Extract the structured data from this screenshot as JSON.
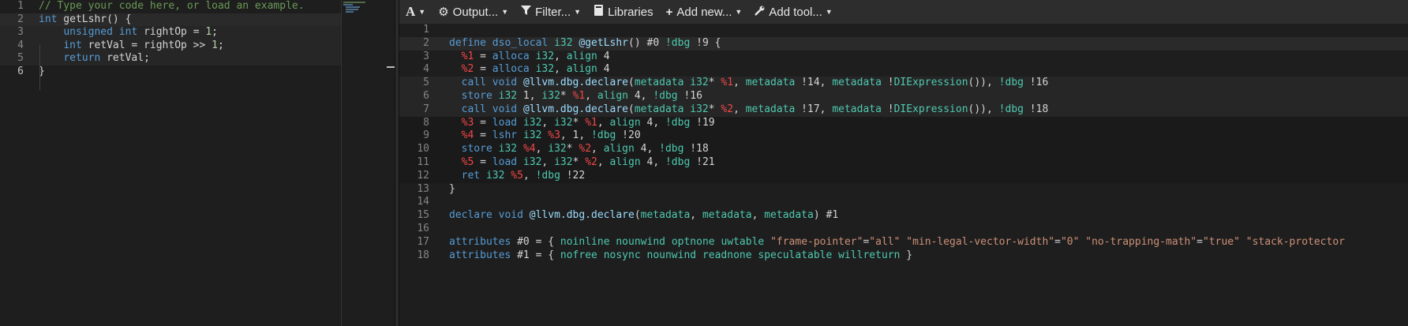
{
  "source_editor": {
    "lines": [
      {
        "num": "1",
        "segments": [
          {
            "t": "// Type your code here, or load an example.",
            "c": "tk-cm"
          }
        ]
      },
      {
        "num": "2",
        "segments": [
          {
            "t": "int",
            "c": "tk-kw"
          },
          {
            "t": " getLshr() {",
            "c": ""
          }
        ]
      },
      {
        "num": "3",
        "segments": [
          {
            "t": "    ",
            "c": ""
          },
          {
            "t": "unsigned",
            "c": "tk-kw"
          },
          {
            "t": " ",
            "c": ""
          },
          {
            "t": "int",
            "c": "tk-kw"
          },
          {
            "t": " rightOp = ",
            "c": ""
          },
          {
            "t": "1",
            "c": "tk-num"
          },
          {
            "t": ";",
            "c": ""
          }
        ]
      },
      {
        "num": "4",
        "segments": [
          {
            "t": "    ",
            "c": ""
          },
          {
            "t": "int",
            "c": "tk-kw"
          },
          {
            "t": " retVal = rightOp >> ",
            "c": ""
          },
          {
            "t": "1",
            "c": "tk-num"
          },
          {
            "t": ";",
            "c": ""
          }
        ]
      },
      {
        "num": "5",
        "segments": [
          {
            "t": "    ",
            "c": ""
          },
          {
            "t": "return",
            "c": "tk-kw"
          },
          {
            "t": " retVal;",
            "c": ""
          }
        ]
      },
      {
        "num": "6",
        "segments": [
          {
            "t": "}",
            "c": ""
          }
        ]
      }
    ]
  },
  "toolbar": {
    "font_label": "A",
    "output_label": "Output...",
    "filter_label": "Filter...",
    "libraries_label": "Libraries",
    "add_new_label": "Add new...",
    "add_tool_label": "Add tool..."
  },
  "output_editor": {
    "lines": [
      {
        "num": "1",
        "segments": []
      },
      {
        "num": "2",
        "segments": [
          {
            "t": "define",
            "c": "tk-kw"
          },
          {
            "t": " ",
            "c": ""
          },
          {
            "t": "dso_local",
            "c": "tk-kw"
          },
          {
            "t": " ",
            "c": ""
          },
          {
            "t": "i32",
            "c": "tk-type"
          },
          {
            "t": " ",
            "c": ""
          },
          {
            "t": "@getLshr",
            "c": "tk-glob"
          },
          {
            "t": "() #0 ",
            "c": ""
          },
          {
            "t": "!dbg",
            "c": "tk-meta"
          },
          {
            "t": " !9 {",
            "c": ""
          }
        ]
      },
      {
        "num": "3",
        "segments": [
          {
            "t": "  ",
            "c": ""
          },
          {
            "t": "%1",
            "c": "tk-reg"
          },
          {
            "t": " = ",
            "c": ""
          },
          {
            "t": "alloca",
            "c": "tk-kw"
          },
          {
            "t": " ",
            "c": ""
          },
          {
            "t": "i32",
            "c": "tk-type"
          },
          {
            "t": ", ",
            "c": ""
          },
          {
            "t": "align",
            "c": "tk-meta"
          },
          {
            "t": " 4",
            "c": ""
          }
        ]
      },
      {
        "num": "4",
        "segments": [
          {
            "t": "  ",
            "c": ""
          },
          {
            "t": "%2",
            "c": "tk-reg"
          },
          {
            "t": " = ",
            "c": ""
          },
          {
            "t": "alloca",
            "c": "tk-kw"
          },
          {
            "t": " ",
            "c": ""
          },
          {
            "t": "i32",
            "c": "tk-type"
          },
          {
            "t": ", ",
            "c": ""
          },
          {
            "t": "align",
            "c": "tk-meta"
          },
          {
            "t": " 4",
            "c": ""
          }
        ]
      },
      {
        "num": "5",
        "segments": [
          {
            "t": "  ",
            "c": ""
          },
          {
            "t": "call",
            "c": "tk-kw"
          },
          {
            "t": " ",
            "c": ""
          },
          {
            "t": "void",
            "c": "tk-kw"
          },
          {
            "t": " ",
            "c": ""
          },
          {
            "t": "@llvm.dbg.declare",
            "c": "tk-glob"
          },
          {
            "t": "(",
            "c": ""
          },
          {
            "t": "metadata",
            "c": "tk-meta"
          },
          {
            "t": " ",
            "c": ""
          },
          {
            "t": "i32",
            "c": "tk-type"
          },
          {
            "t": "* ",
            "c": ""
          },
          {
            "t": "%1",
            "c": "tk-reg"
          },
          {
            "t": ", ",
            "c": ""
          },
          {
            "t": "metadata",
            "c": "tk-meta"
          },
          {
            "t": " !14, ",
            "c": ""
          },
          {
            "t": "metadata",
            "c": "tk-meta"
          },
          {
            "t": " !",
            "c": ""
          },
          {
            "t": "DIExpression",
            "c": "tk-meta"
          },
          {
            "t": "()), ",
            "c": ""
          },
          {
            "t": "!dbg",
            "c": "tk-meta"
          },
          {
            "t": " !16",
            "c": ""
          }
        ]
      },
      {
        "num": "6",
        "segments": [
          {
            "t": "  ",
            "c": ""
          },
          {
            "t": "store",
            "c": "tk-kw"
          },
          {
            "t": " ",
            "c": ""
          },
          {
            "t": "i32",
            "c": "tk-type"
          },
          {
            "t": " 1, ",
            "c": ""
          },
          {
            "t": "i32",
            "c": "tk-type"
          },
          {
            "t": "* ",
            "c": ""
          },
          {
            "t": "%1",
            "c": "tk-reg"
          },
          {
            "t": ", ",
            "c": ""
          },
          {
            "t": "align",
            "c": "tk-meta"
          },
          {
            "t": " 4, ",
            "c": ""
          },
          {
            "t": "!dbg",
            "c": "tk-meta"
          },
          {
            "t": " !16",
            "c": ""
          }
        ]
      },
      {
        "num": "7",
        "segments": [
          {
            "t": "  ",
            "c": ""
          },
          {
            "t": "call",
            "c": "tk-kw"
          },
          {
            "t": " ",
            "c": ""
          },
          {
            "t": "void",
            "c": "tk-kw"
          },
          {
            "t": " ",
            "c": ""
          },
          {
            "t": "@llvm.dbg.declare",
            "c": "tk-glob"
          },
          {
            "t": "(",
            "c": ""
          },
          {
            "t": "metadata",
            "c": "tk-meta"
          },
          {
            "t": " ",
            "c": ""
          },
          {
            "t": "i32",
            "c": "tk-type"
          },
          {
            "t": "* ",
            "c": ""
          },
          {
            "t": "%2",
            "c": "tk-reg"
          },
          {
            "t": ", ",
            "c": ""
          },
          {
            "t": "metadata",
            "c": "tk-meta"
          },
          {
            "t": " !17, ",
            "c": ""
          },
          {
            "t": "metadata",
            "c": "tk-meta"
          },
          {
            "t": " !",
            "c": ""
          },
          {
            "t": "DIExpression",
            "c": "tk-meta"
          },
          {
            "t": "()), ",
            "c": ""
          },
          {
            "t": "!dbg",
            "c": "tk-meta"
          },
          {
            "t": " !18",
            "c": ""
          }
        ]
      },
      {
        "num": "8",
        "segments": [
          {
            "t": "  ",
            "c": ""
          },
          {
            "t": "%3",
            "c": "tk-reg"
          },
          {
            "t": " = ",
            "c": ""
          },
          {
            "t": "load",
            "c": "tk-kw"
          },
          {
            "t": " ",
            "c": ""
          },
          {
            "t": "i32",
            "c": "tk-type"
          },
          {
            "t": ", ",
            "c": ""
          },
          {
            "t": "i32",
            "c": "tk-type"
          },
          {
            "t": "* ",
            "c": ""
          },
          {
            "t": "%1",
            "c": "tk-reg"
          },
          {
            "t": ", ",
            "c": ""
          },
          {
            "t": "align",
            "c": "tk-meta"
          },
          {
            "t": " 4, ",
            "c": ""
          },
          {
            "t": "!dbg",
            "c": "tk-meta"
          },
          {
            "t": " !19",
            "c": ""
          }
        ]
      },
      {
        "num": "9",
        "segments": [
          {
            "t": "  ",
            "c": ""
          },
          {
            "t": "%4",
            "c": "tk-reg"
          },
          {
            "t": " = ",
            "c": ""
          },
          {
            "t": "lshr",
            "c": "tk-kw"
          },
          {
            "t": " ",
            "c": ""
          },
          {
            "t": "i32",
            "c": "tk-type"
          },
          {
            "t": " ",
            "c": ""
          },
          {
            "t": "%3",
            "c": "tk-reg"
          },
          {
            "t": ", 1, ",
            "c": ""
          },
          {
            "t": "!dbg",
            "c": "tk-meta"
          },
          {
            "t": " !20",
            "c": ""
          }
        ]
      },
      {
        "num": "10",
        "segments": [
          {
            "t": "  ",
            "c": ""
          },
          {
            "t": "store",
            "c": "tk-kw"
          },
          {
            "t": " ",
            "c": ""
          },
          {
            "t": "i32",
            "c": "tk-type"
          },
          {
            "t": " ",
            "c": ""
          },
          {
            "t": "%4",
            "c": "tk-reg"
          },
          {
            "t": ", ",
            "c": ""
          },
          {
            "t": "i32",
            "c": "tk-type"
          },
          {
            "t": "* ",
            "c": ""
          },
          {
            "t": "%2",
            "c": "tk-reg"
          },
          {
            "t": ", ",
            "c": ""
          },
          {
            "t": "align",
            "c": "tk-meta"
          },
          {
            "t": " 4, ",
            "c": ""
          },
          {
            "t": "!dbg",
            "c": "tk-meta"
          },
          {
            "t": " !18",
            "c": ""
          }
        ]
      },
      {
        "num": "11",
        "segments": [
          {
            "t": "  ",
            "c": ""
          },
          {
            "t": "%5",
            "c": "tk-reg"
          },
          {
            "t": " = ",
            "c": ""
          },
          {
            "t": "load",
            "c": "tk-kw"
          },
          {
            "t": " ",
            "c": ""
          },
          {
            "t": "i32",
            "c": "tk-type"
          },
          {
            "t": ", ",
            "c": ""
          },
          {
            "t": "i32",
            "c": "tk-type"
          },
          {
            "t": "* ",
            "c": ""
          },
          {
            "t": "%2",
            "c": "tk-reg"
          },
          {
            "t": ", ",
            "c": ""
          },
          {
            "t": "align",
            "c": "tk-meta"
          },
          {
            "t": " 4, ",
            "c": ""
          },
          {
            "t": "!dbg",
            "c": "tk-meta"
          },
          {
            "t": " !21",
            "c": ""
          }
        ]
      },
      {
        "num": "12",
        "segments": [
          {
            "t": "  ",
            "c": ""
          },
          {
            "t": "ret",
            "c": "tk-kw"
          },
          {
            "t": " ",
            "c": ""
          },
          {
            "t": "i32",
            "c": "tk-type"
          },
          {
            "t": " ",
            "c": ""
          },
          {
            "t": "%5",
            "c": "tk-reg"
          },
          {
            "t": ", ",
            "c": ""
          },
          {
            "t": "!dbg",
            "c": "tk-meta"
          },
          {
            "t": " !22",
            "c": ""
          }
        ]
      },
      {
        "num": "13",
        "segments": [
          {
            "t": "}",
            "c": ""
          }
        ]
      },
      {
        "num": "14",
        "segments": []
      },
      {
        "num": "15",
        "segments": [
          {
            "t": "declare",
            "c": "tk-kw"
          },
          {
            "t": " ",
            "c": ""
          },
          {
            "t": "void",
            "c": "tk-kw"
          },
          {
            "t": " ",
            "c": ""
          },
          {
            "t": "@llvm.dbg.declare",
            "c": "tk-glob"
          },
          {
            "t": "(",
            "c": ""
          },
          {
            "t": "metadata",
            "c": "tk-meta"
          },
          {
            "t": ", ",
            "c": ""
          },
          {
            "t": "metadata",
            "c": "tk-meta"
          },
          {
            "t": ", ",
            "c": ""
          },
          {
            "t": "metadata",
            "c": "tk-meta"
          },
          {
            "t": ") #1",
            "c": ""
          }
        ]
      },
      {
        "num": "16",
        "segments": []
      },
      {
        "num": "17",
        "segments": [
          {
            "t": "attributes",
            "c": "tk-kw"
          },
          {
            "t": " #0 = { ",
            "c": ""
          },
          {
            "t": "noinline",
            "c": "tk-meta"
          },
          {
            "t": " ",
            "c": ""
          },
          {
            "t": "nounwind",
            "c": "tk-meta"
          },
          {
            "t": " ",
            "c": ""
          },
          {
            "t": "optnone",
            "c": "tk-meta"
          },
          {
            "t": " ",
            "c": ""
          },
          {
            "t": "uwtable",
            "c": "tk-meta"
          },
          {
            "t": " ",
            "c": ""
          },
          {
            "t": "\"frame-pointer\"",
            "c": "tk-str"
          },
          {
            "t": "=",
            "c": ""
          },
          {
            "t": "\"all\"",
            "c": "tk-str"
          },
          {
            "t": " ",
            "c": ""
          },
          {
            "t": "\"min-legal-vector-width\"",
            "c": "tk-str"
          },
          {
            "t": "=",
            "c": ""
          },
          {
            "t": "\"0\"",
            "c": "tk-str"
          },
          {
            "t": " ",
            "c": ""
          },
          {
            "t": "\"no-trapping-math\"",
            "c": "tk-str"
          },
          {
            "t": "=",
            "c": ""
          },
          {
            "t": "\"true\"",
            "c": "tk-str"
          },
          {
            "t": " ",
            "c": ""
          },
          {
            "t": "\"stack-protector",
            "c": "tk-str"
          }
        ]
      },
      {
        "num": "18",
        "segments": [
          {
            "t": "attributes",
            "c": "tk-kw"
          },
          {
            "t": " #1 = { ",
            "c": ""
          },
          {
            "t": "nofree",
            "c": "tk-meta"
          },
          {
            "t": " ",
            "c": ""
          },
          {
            "t": "nosync",
            "c": "tk-meta"
          },
          {
            "t": " ",
            "c": ""
          },
          {
            "t": "nounwind",
            "c": "tk-meta"
          },
          {
            "t": " ",
            "c": ""
          },
          {
            "t": "readnone",
            "c": "tk-meta"
          },
          {
            "t": " ",
            "c": ""
          },
          {
            "t": "speculatable",
            "c": "tk-meta"
          },
          {
            "t": " ",
            "c": ""
          },
          {
            "t": "willreturn",
            "c": "tk-meta"
          },
          {
            "t": " }",
            "c": ""
          }
        ]
      }
    ]
  }
}
